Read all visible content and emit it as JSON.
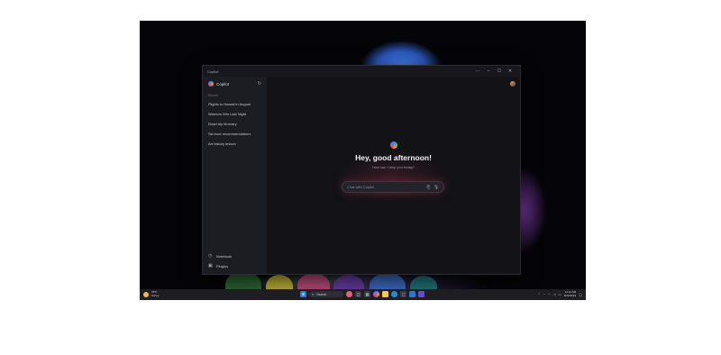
{
  "window": {
    "title": "Copilot",
    "controls": {
      "more": "···",
      "minimize": "–",
      "maximize": "☐",
      "close": "✕"
    }
  },
  "sidebar": {
    "app_name": "Copilot",
    "recent_label": "Recent",
    "recent_items": [
      "Flights to Hawaii in August",
      "Warriors Win Last Night",
      "Road trip itinerary",
      "Ski boot recommendations",
      "Art history lesson"
    ],
    "bottom_links": [
      {
        "label": "Notebook",
        "icon": "notebook-icon"
      },
      {
        "label": "Plugins",
        "icon": "plugins-icon"
      }
    ]
  },
  "main": {
    "greeting": "Hey, good afternoon!",
    "subtitle": "How can I help you today?",
    "chat": {
      "placeholder": "Chat with Copilot"
    }
  },
  "taskbar": {
    "weather": {
      "temp": "78°F",
      "condition": "Sunny"
    },
    "search_label": "Search",
    "clock": {
      "time": "11:11 AM",
      "date": "6/22/2024"
    }
  },
  "colors": {
    "window_bg": "#17171d",
    "sidebar_bg": "#1c1c23",
    "accent_glow": "#a03246",
    "taskbar_bg": "#1d1d22"
  }
}
